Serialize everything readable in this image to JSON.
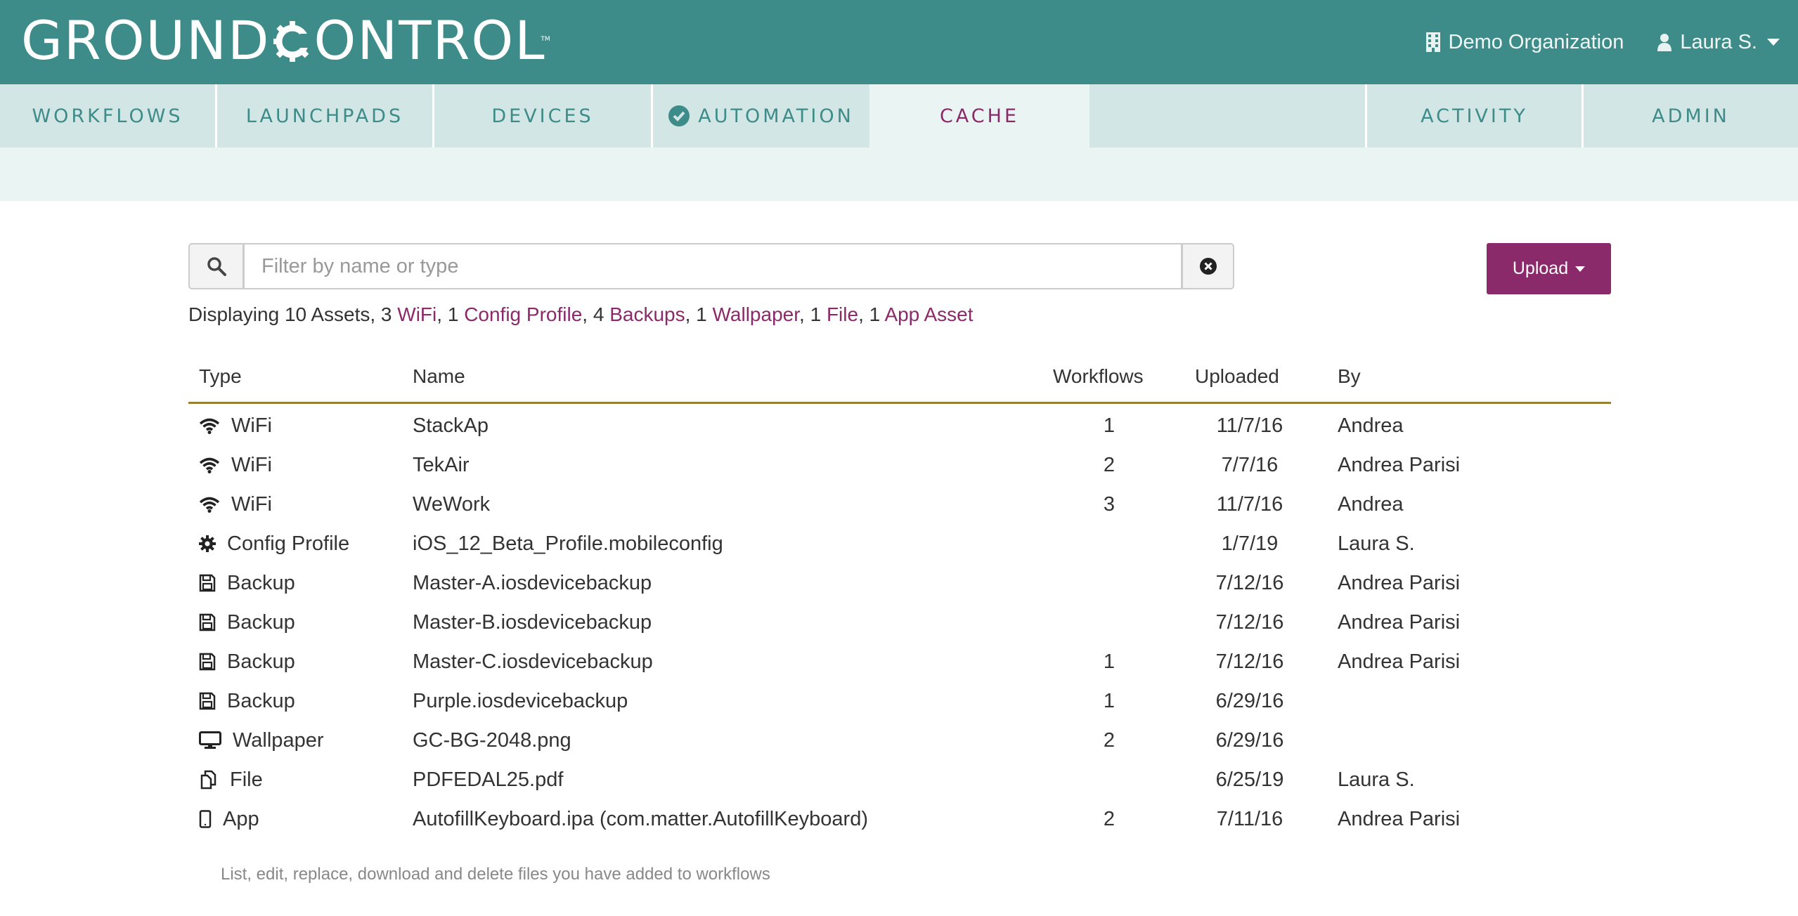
{
  "header": {
    "logo_text_1": "GROUND",
    "logo_text_2": "ONTROL",
    "logo_tm": "TM",
    "organization": "Demo Organization",
    "user": "Laura S."
  },
  "nav": {
    "tabs": [
      {
        "label": "WORKFLOWS"
      },
      {
        "label": "LAUNCHPADS"
      },
      {
        "label": "DEVICES"
      },
      {
        "label": "AUTOMATION"
      },
      {
        "label": "CACHE"
      },
      {
        "label": "ACTIVITY"
      },
      {
        "label": "ADMIN"
      }
    ],
    "active": "CACHE"
  },
  "filter": {
    "placeholder": "Filter by name or type",
    "value": ""
  },
  "upload_label": "Upload",
  "summary": {
    "prefix": "Displaying 10 Assets, 3 ",
    "wifi": "WiFi",
    "s1": ", 1 ",
    "config": "Config Profile",
    "s2": ", 4 ",
    "backups": "Backups",
    "s3": ", 1 ",
    "wallpaper": "Wallpaper",
    "s4": ", 1 ",
    "file": "File",
    "s5": ", 1 ",
    "app": "App Asset"
  },
  "table": {
    "headers": {
      "type": "Type",
      "name": "Name",
      "workflows": "Workflows",
      "uploaded": "Uploaded",
      "by": "By"
    },
    "rows": [
      {
        "icon": "wifi-icon",
        "type": "WiFi",
        "name": "StackAp",
        "workflows": "1",
        "uploaded": "11/7/16",
        "by": "Andrea"
      },
      {
        "icon": "wifi-icon",
        "type": "WiFi",
        "name": "TekAir",
        "workflows": "2",
        "uploaded": "7/7/16",
        "by": "Andrea Parisi"
      },
      {
        "icon": "wifi-icon",
        "type": "WiFi",
        "name": "WeWork",
        "workflows": "3",
        "uploaded": "11/7/16",
        "by": "Andrea"
      },
      {
        "icon": "gear-icon",
        "type": "Config Profile",
        "name": "iOS_12_Beta_Profile.mobileconfig",
        "workflows": "",
        "uploaded": "1/7/19",
        "by": "Laura S."
      },
      {
        "icon": "floppy-disk-icon",
        "type": "Backup",
        "name": "Master-A.iosdevicebackup",
        "workflows": "",
        "uploaded": "7/12/16",
        "by": "Andrea Parisi"
      },
      {
        "icon": "floppy-disk-icon",
        "type": "Backup",
        "name": "Master-B.iosdevicebackup",
        "workflows": "",
        "uploaded": "7/12/16",
        "by": "Andrea Parisi"
      },
      {
        "icon": "floppy-disk-icon",
        "type": "Backup",
        "name": "Master-C.iosdevicebackup",
        "workflows": "1",
        "uploaded": "7/12/16",
        "by": "Andrea Parisi"
      },
      {
        "icon": "floppy-disk-icon",
        "type": "Backup",
        "name": "Purple.iosdevicebackup",
        "workflows": "1",
        "uploaded": "6/29/16",
        "by": ""
      },
      {
        "icon": "monitor-icon",
        "type": "Wallpaper",
        "name": "GC-BG-2048.png",
        "workflows": "2",
        "uploaded": "6/29/16",
        "by": ""
      },
      {
        "icon": "files-icon",
        "type": "File",
        "name": "PDFEDAL25.pdf",
        "workflows": "",
        "uploaded": "6/25/19",
        "by": "Laura S."
      },
      {
        "icon": "mobile-phone-icon",
        "type": "App",
        "name": "AutofillKeyboard.ipa (com.matter.AutofillKeyboard)",
        "workflows": "2",
        "uploaded": "7/11/16",
        "by": "Andrea Parisi"
      }
    ]
  },
  "footer_note": "List, edit, replace, download and delete files you have added to workflows",
  "colors": {
    "header_bg": "#3d8c89",
    "nav_bg": "#d2e6e5",
    "accent": "#8b2a6b",
    "rule": "#9b7f33"
  }
}
